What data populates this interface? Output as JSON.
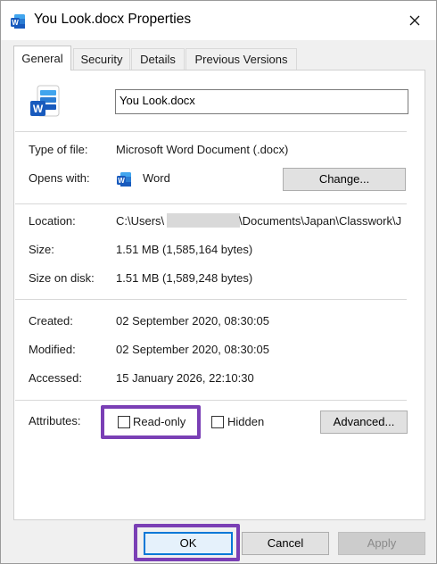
{
  "window": {
    "title": "You Look.docx Properties",
    "title_icon": "word-document-icon",
    "close_icon": "close-icon"
  },
  "tabs": [
    {
      "label": "General",
      "active": true
    },
    {
      "label": "Security",
      "active": false
    },
    {
      "label": "Details",
      "active": false
    },
    {
      "label": "Previous Versions",
      "active": false
    }
  ],
  "general": {
    "file_icon": "word-document-icon",
    "file_name": "You Look.docx",
    "type_label": "Type of file:",
    "type_value": "Microsoft Word Document (.docx)",
    "opens_label": "Opens with:",
    "opens_app_icon": "word-app-icon",
    "opens_value": "Word",
    "change_button": "Change...",
    "location_label": "Location:",
    "location_prefix": "C:\\Users\\",
    "location_suffix": "\\Documents\\Japan\\Classwork\\J",
    "size_label": "Size:",
    "size_value": "1.51 MB (1,585,164 bytes)",
    "size_on_disk_label": "Size on disk:",
    "size_on_disk_value": "1.51 MB (1,589,248 bytes)",
    "created_label": "Created:",
    "created_value": "02 September 2020, 08:30:05",
    "modified_label": "Modified:",
    "modified_value": "02 September 2020, 08:30:05",
    "accessed_label": "Accessed:",
    "accessed_value": "15 January 2026, 22:10:30",
    "attributes_label": "Attributes:",
    "readonly_label": "Read-only",
    "readonly_checked": false,
    "hidden_label": "Hidden",
    "hidden_checked": false,
    "advanced_button": "Advanced..."
  },
  "footer": {
    "ok": "OK",
    "cancel": "Cancel",
    "apply": "Apply"
  },
  "colors": {
    "highlight": "#7a3fb5",
    "word_blue": "#185abd",
    "focus_blue": "#0078d7"
  }
}
